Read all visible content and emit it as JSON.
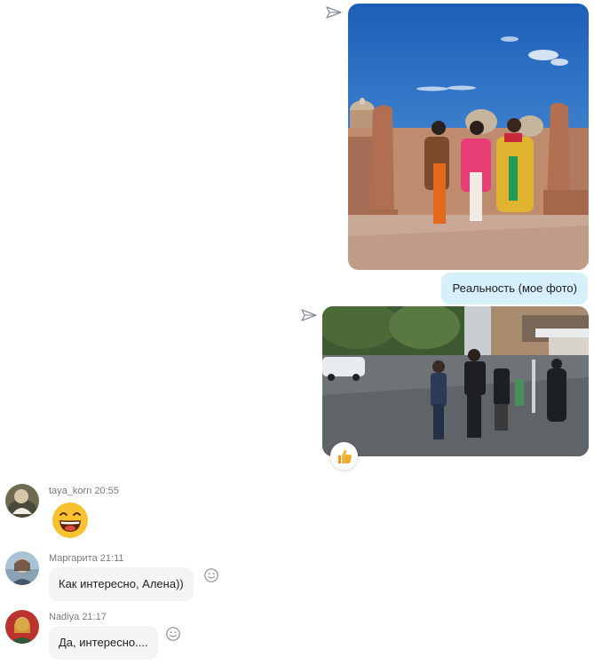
{
  "outgoing": {
    "caption": "Реальность (мое фото)",
    "reaction_emoji": "👍"
  },
  "incoming": [
    {
      "user": "taya_korn",
      "time": "20:55",
      "text": "",
      "emoji": "😄"
    },
    {
      "user": "Маргарита",
      "time": "21:11",
      "text": "Как интересно, Алена))"
    },
    {
      "user": "Nadiya",
      "time": "21:17",
      "text": "Да, интересно...."
    }
  ],
  "icons": [
    "send-icon",
    "thumbs-up-icon",
    "add-reaction-icon",
    "laughing-emoji-icon"
  ],
  "colors": {
    "outgoing_bubble": "#d6f0fb",
    "incoming_bubble": "#f2f4f6",
    "meta_text": "#7a7a7a",
    "emoji_yellow": "#f7c130"
  }
}
